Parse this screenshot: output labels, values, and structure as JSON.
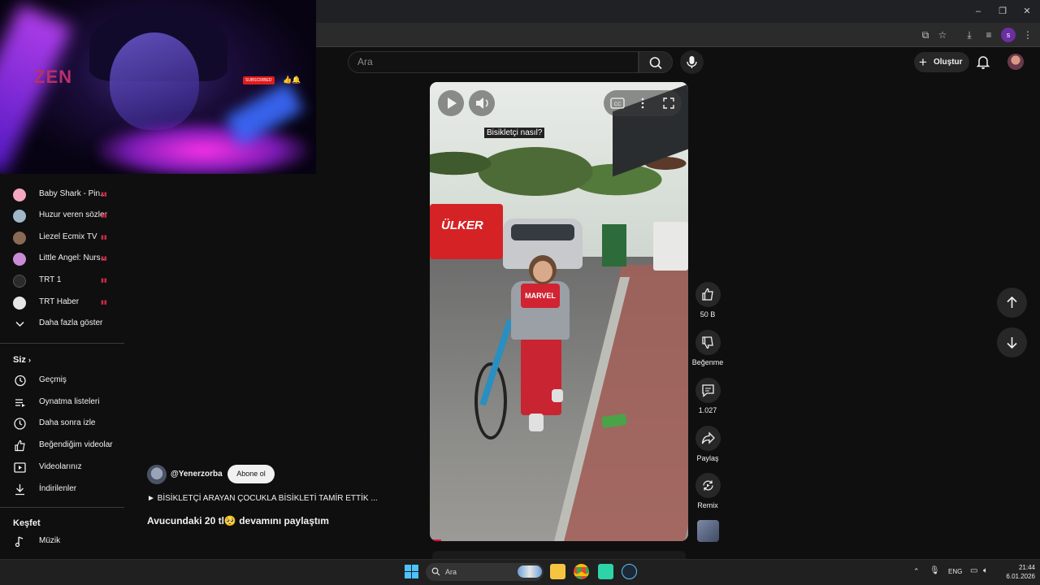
{
  "browser": {
    "window_controls": {
      "minimize": "–",
      "maximize": "❐",
      "close": "✕"
    }
  },
  "overlay": {
    "logo_text": "ZEN",
    "subscribe_badge": "SUBSCRIBED"
  },
  "header": {
    "search_placeholder": "Ara",
    "create_label": "Oluştur"
  },
  "sidebar": {
    "subscriptions": [
      {
        "label": "Baby Shark - Pin...",
        "avatar_color": "#f4a7c0"
      },
      {
        "label": "Huzur veren sözler",
        "avatar_color": "#9fb7c9"
      },
      {
        "label": "Liezel Ecmix TV",
        "avatar_color": "#8a6a55"
      },
      {
        "label": "Little Angel: Nurs...",
        "avatar_color": "#c98bd6"
      },
      {
        "label": "TRT 1",
        "avatar_color": "#2b2b2b"
      },
      {
        "label": "TRT Haber",
        "avatar_color": "#e6e6e6"
      }
    ],
    "show_more": "Daha fazla göster",
    "you_section": {
      "title": "Siz",
      "items": [
        {
          "label": "Geçmiş",
          "icon": "history-icon"
        },
        {
          "label": "Oynatma listeleri",
          "icon": "playlists-icon"
        },
        {
          "label": "Daha sonra izle",
          "icon": "watch-later-icon"
        },
        {
          "label": "Beğendiğim videolar",
          "icon": "liked-icon"
        },
        {
          "label": "Videolarınız",
          "icon": "your-videos-icon"
        },
        {
          "label": "İndirilenler",
          "icon": "downloads-icon"
        }
      ]
    },
    "explore_section": {
      "title": "Keşfet",
      "items": [
        {
          "label": "Müzik",
          "icon": "music-icon"
        }
      ]
    }
  },
  "short": {
    "caption": "Bisikletçi nasıl?",
    "truck_logo": "ÜLKER",
    "shirt_text": "MARVEL",
    "channel": "@Yenerzorba",
    "subscribe_label": "Abone ol",
    "music_line": "► BİSİKLETÇİ ARAYAN ÇOCUKLA BİSİKLETİ TAMİR ETTİK ...",
    "title": "Avucundaki 20 tl🥺 devamını paylaştım",
    "actions": {
      "like_count": "50 B",
      "dislike_label": "Beğenme",
      "comment_count": "1.027",
      "share_label": "Paylaş",
      "remix_label": "Remix"
    }
  },
  "taskbar": {
    "search_label": "Ara",
    "language": "ENG",
    "time": "21:44",
    "date": "6.01.2026"
  },
  "colors": {
    "background": "#0f0f0f",
    "accent_red": "#ff0033",
    "live_indicator": "#c62b46"
  }
}
